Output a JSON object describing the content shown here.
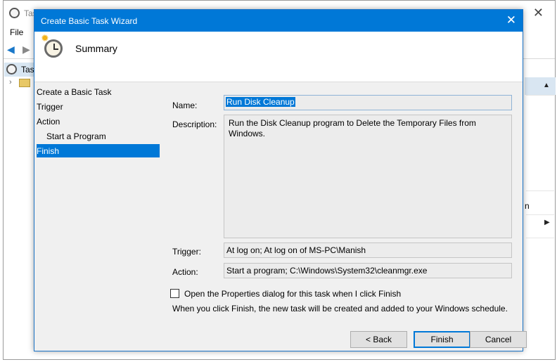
{
  "background_window": {
    "title": "Tas",
    "menu": {
      "file": "File"
    },
    "tree": {
      "root": "Tas"
    },
    "right_panel": {
      "fragment": "n"
    }
  },
  "dialog": {
    "title": "Create Basic Task Wizard",
    "header_title": "Summary",
    "steps": [
      {
        "label": "Create a Basic Task"
      },
      {
        "label": "Trigger"
      },
      {
        "label": "Action"
      },
      {
        "label": "Start a Program"
      },
      {
        "label": "Finish"
      }
    ],
    "active_step": "Finish",
    "fields": {
      "name_label": "Name:",
      "name_value": "Run Disk Cleanup",
      "description_label": "Description:",
      "description_value": "Run the Disk Cleanup program to Delete the Temporary Files from Windows.",
      "trigger_label": "Trigger:",
      "trigger_value": "At log on; At log on of MS-PC\\Manish",
      "action_label": "Action:",
      "action_value": "Start a program; C:\\Windows\\System32\\cleanmgr.exe"
    },
    "open_properties_checkbox": {
      "label": "Open the Properties dialog for this task when I click Finish",
      "checked": false
    },
    "info_text": "When you click Finish, the new task will be created and added to your Windows schedule.",
    "buttons": {
      "back": "< Back",
      "finish": "Finish",
      "cancel": "Cancel"
    }
  },
  "colors": {
    "accent": "#0078d7",
    "dialog_bg": "#f0f0f0"
  }
}
